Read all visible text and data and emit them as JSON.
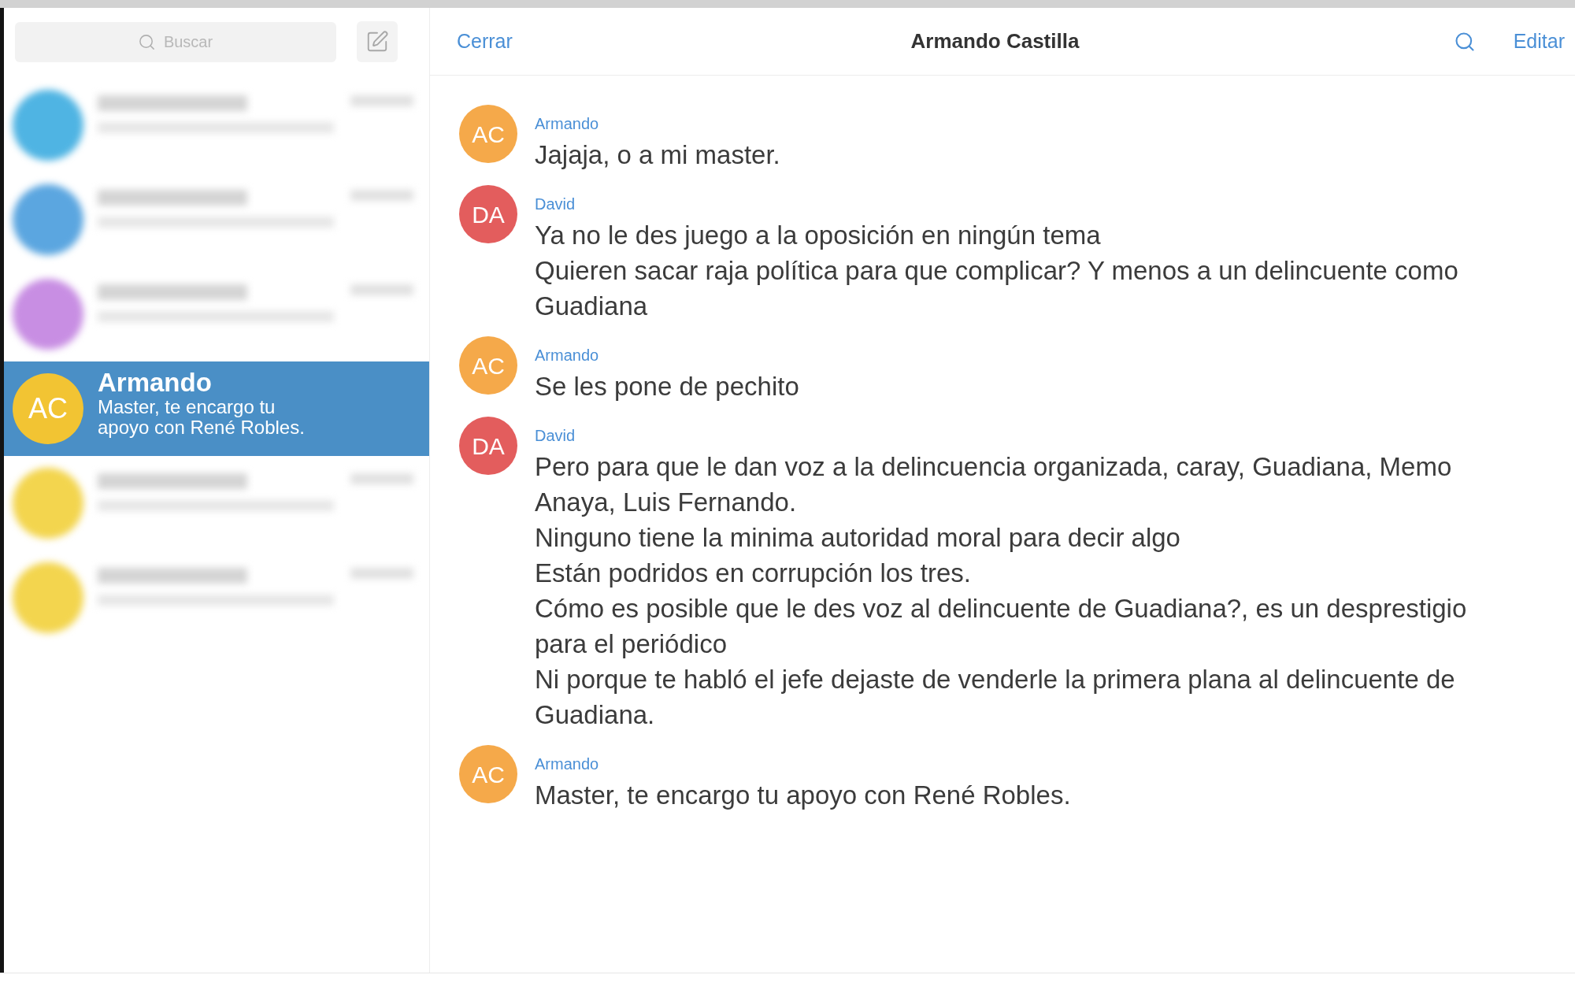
{
  "sidebar": {
    "search": {
      "placeholder": "Buscar"
    },
    "conversations": [
      {
        "kind": "redacted",
        "color": "#4fb4e3",
        "selected": false
      },
      {
        "kind": "redacted",
        "color": "#5ba6e0",
        "selected": false
      },
      {
        "kind": "redacted",
        "color": "#c88ee3",
        "selected": false
      },
      {
        "kind": "chat",
        "initials": "AC",
        "name": "Armando",
        "preview": "Master, te encargo tu apoyo con René Robles.",
        "color": "#f2c433",
        "selected": true
      },
      {
        "kind": "redacted",
        "color": "#f3d54e",
        "selected": false
      },
      {
        "kind": "redacted",
        "color": "#f3d54e",
        "selected": false
      }
    ]
  },
  "chat": {
    "header": {
      "close": "Cerrar",
      "title": "Armando Castilla",
      "edit": "Editar"
    },
    "messages": [
      {
        "initials": "AC",
        "sender": "Armando",
        "color": "#f5a94a",
        "lines": [
          "Jajaja, o a mi master."
        ]
      },
      {
        "initials": "DA",
        "sender": "David",
        "color": "#e35d5d",
        "lines": [
          "Ya no le des juego a la oposición en ningún tema",
          "Quieren sacar raja política para que complicar? Y menos a un delincuente como Guadiana"
        ]
      },
      {
        "initials": "AC",
        "sender": "Armando",
        "color": "#f5a94a",
        "lines": [
          "Se les pone de pechito"
        ]
      },
      {
        "initials": "DA",
        "sender": "David",
        "color": "#e35d5d",
        "lines": [
          "Pero para que le dan voz a la delincuencia organizada, caray, Guadiana, Memo Anaya, Luis Fernando.",
          "Ninguno tiene la minima autoridad moral para decir algo",
          "Están podridos en corrupción los tres.",
          "Cómo es posible que le des voz al delincuente de Guadiana?, es un desprestigio para el periódico",
          "Ni porque te habló el jefe dejaste de venderle la primera plana al delincuente de Guadiana."
        ]
      },
      {
        "initials": "AC",
        "sender": "Armando",
        "color": "#f5a94a",
        "lines": [
          "Master, te encargo tu apoyo con René Robles."
        ]
      }
    ]
  }
}
